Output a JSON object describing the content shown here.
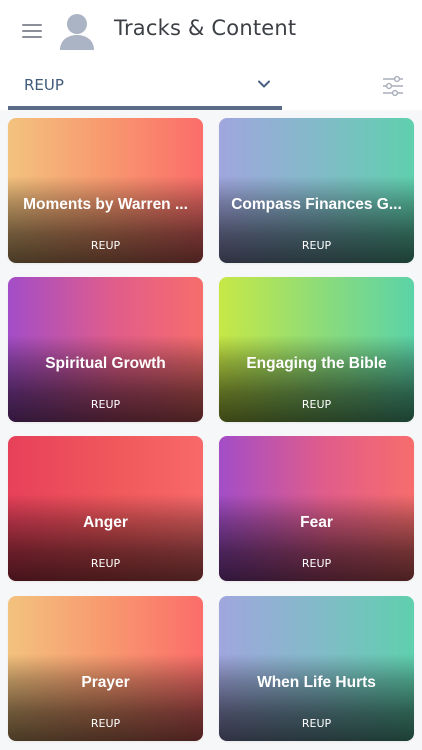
{
  "header": {
    "title": "Tracks & Content",
    "menu_icon": "hamburger-menu-icon",
    "avatar_icon": "user-avatar-icon"
  },
  "filter": {
    "selected_track": "REUP",
    "chevron_icon": "chevron-down-icon",
    "filter_icon": "sliders-filter-icon"
  },
  "colors": {
    "title_text": "#3c3f44",
    "select_text": "#3f5a7a",
    "tab_underline": "#5b6a86"
  },
  "cards": [
    {
      "title": "Moments by Warren ...",
      "track": "REUP",
      "gradient": [
        "#f3c27e",
        "#fb6d6a"
      ]
    },
    {
      "title": "Compass Finances G...",
      "track": "REUP",
      "gradient": [
        "#a0a6de",
        "#5fd0ad"
      ]
    },
    {
      "title": "Spiritual Growth",
      "track": "REUP",
      "gradient": [
        "#a34dc8",
        "#f76d6c"
      ]
    },
    {
      "title": "Engaging the Bible",
      "track": "REUP",
      "gradient": [
        "#c7e846",
        "#5bd3a8"
      ]
    },
    {
      "title": "Anger",
      "track": "REUP",
      "gradient": [
        "#e7405a",
        "#f8696a"
      ]
    },
    {
      "title": "Fear",
      "track": "REUP",
      "gradient": [
        "#a34dc8",
        "#f76d6c"
      ]
    },
    {
      "title": "Prayer",
      "track": "REUP",
      "gradient": [
        "#f3c27e",
        "#fb6d6a"
      ]
    },
    {
      "title": "When Life Hurts",
      "track": "REUP",
      "gradient": [
        "#a0a6de",
        "#5fd0ad"
      ]
    }
  ]
}
